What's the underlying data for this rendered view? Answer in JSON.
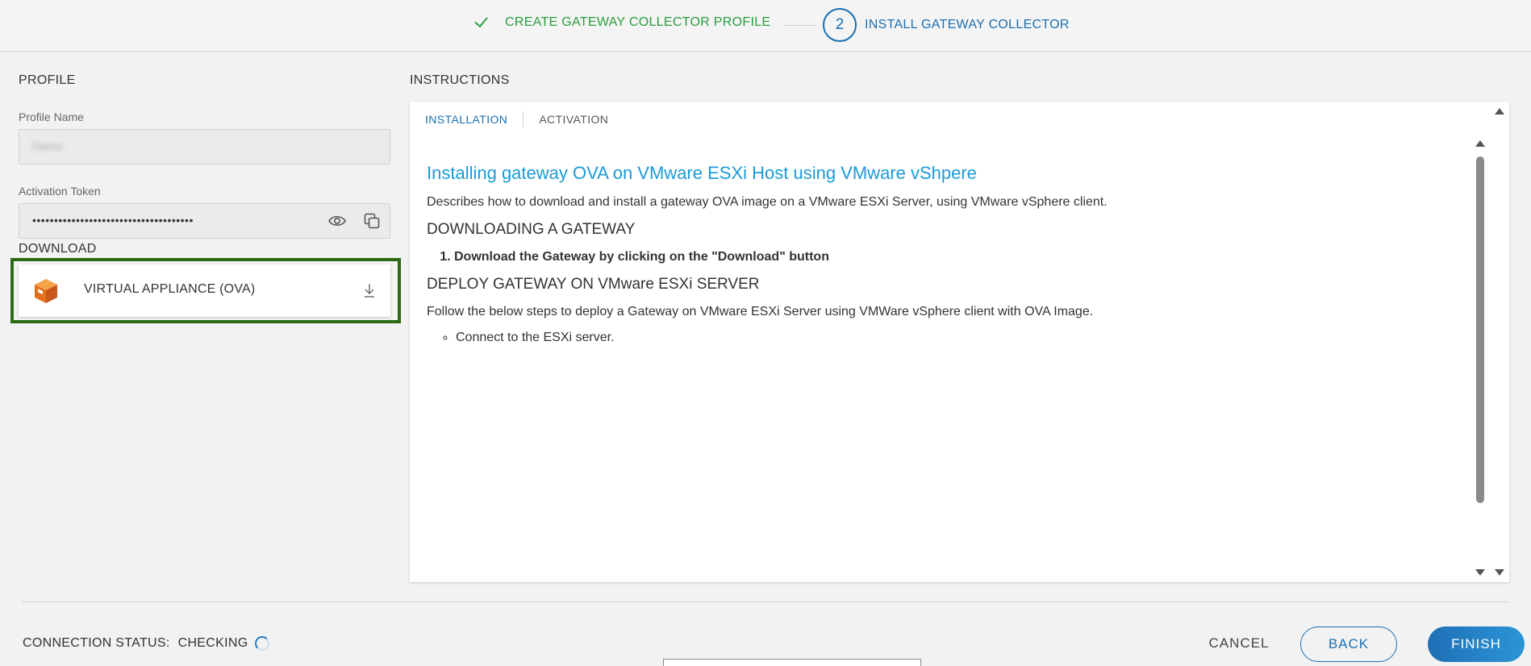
{
  "stepper": {
    "step1_label": "CREATE GATEWAY COLLECTOR PROFILE",
    "step2_number": "2",
    "step2_label": "INSTALL GATEWAY COLLECTOR"
  },
  "profile": {
    "section_title": "PROFILE",
    "name_label": "Profile Name",
    "name_value": "Demo",
    "token_label": "Activation Token",
    "token_value": "•••••••••••••••••••••••••••••••••••••"
  },
  "download": {
    "section_title": "DOWNLOAD",
    "item_label": "VIRTUAL APPLIANCE (OVA)"
  },
  "instructions": {
    "section_title": "INSTRUCTIONS",
    "tabs": [
      {
        "label": "INSTALLATION",
        "active": true
      },
      {
        "label": "ACTIVATION",
        "active": false
      }
    ],
    "heading": "Installing gateway OVA on VMware ESXi Host using VMware vShpere",
    "description": "Describes how to download and install a gateway OVA image on a VMware ESXi Server, using VMware vSphere client.",
    "section1_title": "DOWNLOADING A GATEWAY",
    "section1_steps": [
      "Download the Gateway by clicking on the \"Download\" button"
    ],
    "section2_title": "DEPLOY GATEWAY ON VMware ESXi SERVER",
    "section2_text": "Follow the below steps to deploy a Gateway on VMware ESXi Server using VMWare vSphere client with OVA Image.",
    "section2_bullets": [
      "Connect to the ESXi server."
    ]
  },
  "footer": {
    "status_label": "CONNECTION STATUS:",
    "status_value": "CHECKING",
    "cancel_label": "CANCEL",
    "back_label": "BACK",
    "finish_label": "FINISH"
  },
  "colors": {
    "success": "#2a9d3e",
    "primary": "#1a6fb0",
    "heading_link": "#1a9ad6",
    "highlight_border": "#2d6a14"
  }
}
